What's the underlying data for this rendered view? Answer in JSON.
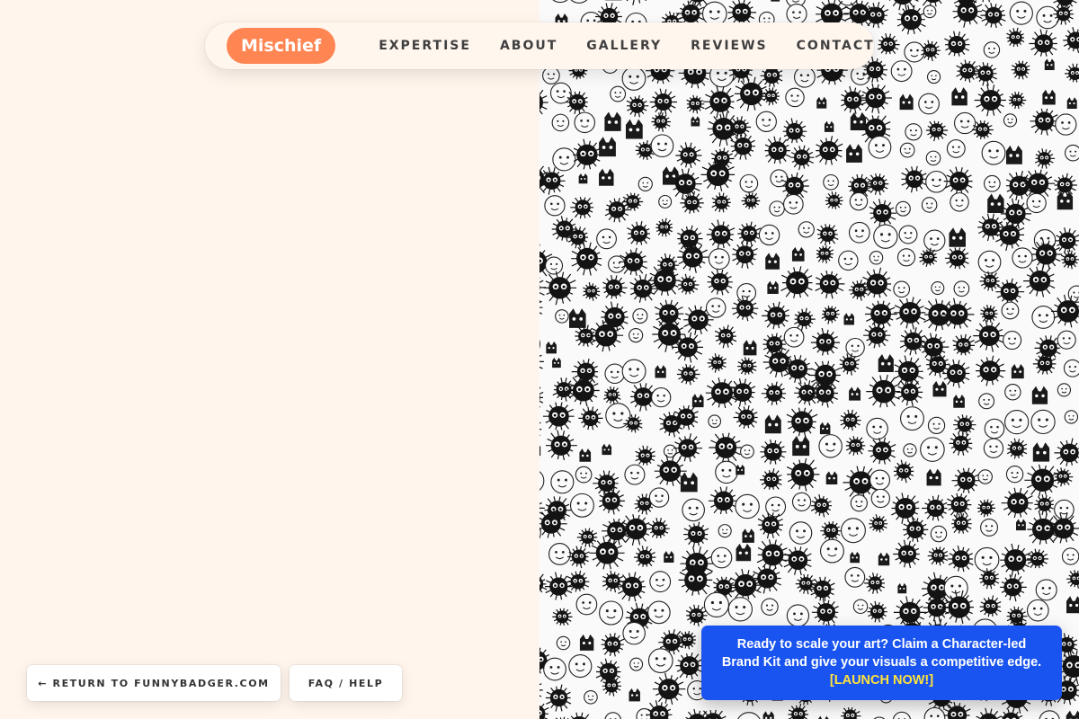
{
  "nav": {
    "logo": "Mischief",
    "links": [
      "EXPERTISE",
      "ABOUT",
      "GALLERY",
      "REVIEWS",
      "CONTACT"
    ]
  },
  "buttons": {
    "return_label": "← RETURN TO FUNNYBADGER.COM",
    "faq_label": "FAQ / HELP"
  },
  "cta": {
    "line1": "Ready to scale your art? Claim a Character-led",
    "line2": "Brand Kit and give your visuals a competitive edge.",
    "link": "[LAUNCH NOW!]"
  },
  "colors": {
    "background": "#fff5ec",
    "logo_accent": "#ff8552",
    "cta_background": "#1a54f0",
    "cta_link": "#ffe33a"
  }
}
